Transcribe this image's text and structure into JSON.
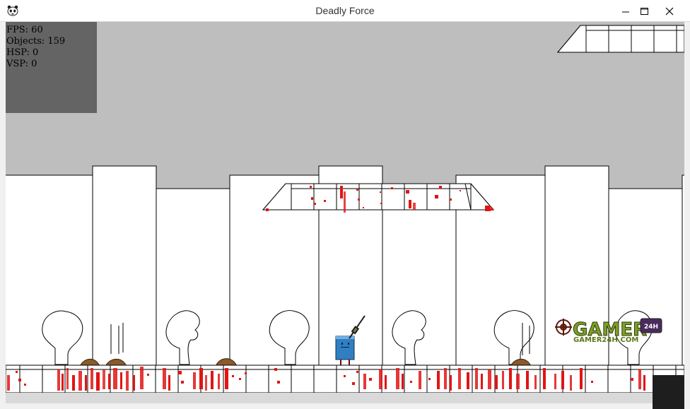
{
  "window": {
    "title": "Deadly Force",
    "icon": "skull-panda-icon",
    "controls": {
      "minimize": "minimize-icon",
      "maximize": "maximize-icon",
      "close": "close-icon"
    }
  },
  "hud": {
    "fps": "FPS: 60",
    "objects": "Objects: 159",
    "hsp": "HSP: 0",
    "vsp": "VSP: 0"
  },
  "watermark": {
    "brand": "GAMER",
    "badge": "24H",
    "url": "GAMER24H.COM"
  },
  "colors": {
    "sky": "#bebebe",
    "blood": "#e01515",
    "player": "#2f7fc2",
    "dirt": "#8a5a2b",
    "watermark_green": "#6b8a1c"
  }
}
